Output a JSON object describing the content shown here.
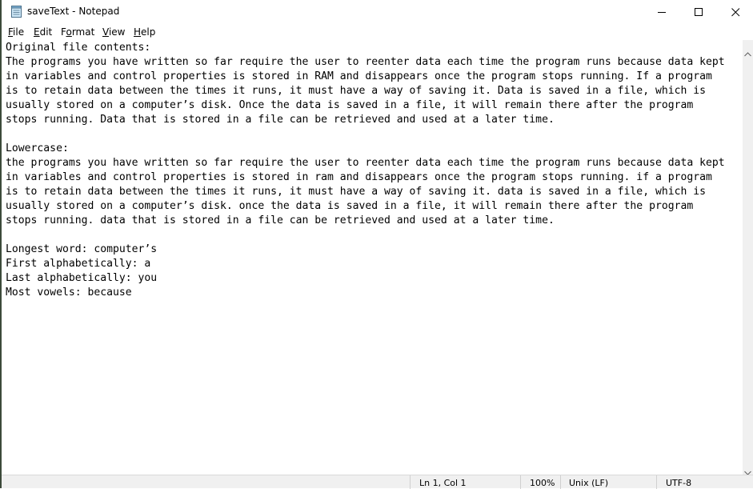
{
  "window": {
    "title": "saveText - Notepad"
  },
  "menu": {
    "file": {
      "accel": "F",
      "rest": "ile"
    },
    "edit": {
      "accel": "E",
      "rest": "dit"
    },
    "format": {
      "pre": "F",
      "accel": "o",
      "rest": "rmat"
    },
    "view": {
      "accel": "V",
      "rest": "iew"
    },
    "help": {
      "accel": "H",
      "rest": "elp"
    }
  },
  "editor": {
    "content": "Original file contents:\nThe programs you have written so far require the user to reenter data each time the program runs because data kept\nin variables and control properties is stored in RAM and disappears once the program stops running. If a program\nis to retain data between the times it runs, it must have a way of saving it. Data is saved in a file, which is\nusually stored on a computer’s disk. Once the data is saved in a file, it will remain there after the program\nstops running. Data that is stored in a file can be retrieved and used at a later time.\n\nLowercase:\nthe programs you have written so far require the user to reenter data each time the program runs because data kept\nin variables and control properties is stored in ram and disappears once the program stops running. if a program\nis to retain data between the times it runs, it must have a way of saving it. data is saved in a file, which is\nusually stored on a computer’s disk. once the data is saved in a file, it will remain there after the program\nstops running. data that is stored in a file can be retrieved and used at a later time.\n\nLongest word: computer’s\nFirst alphabetically: a\nLast alphabetically: you\nMost vowels: because"
  },
  "status": {
    "position": "Ln 1, Col 1",
    "zoom": "100%",
    "line_ending": "Unix (LF)",
    "encoding": "UTF-8"
  },
  "icons": {
    "app": "notepad-icon",
    "minimize": "minimize-icon",
    "maximize": "maximize-icon",
    "close": "close-icon",
    "scroll_up": "scroll-up-arrow-icon",
    "scroll_down": "scroll-down-arrow-icon"
  }
}
